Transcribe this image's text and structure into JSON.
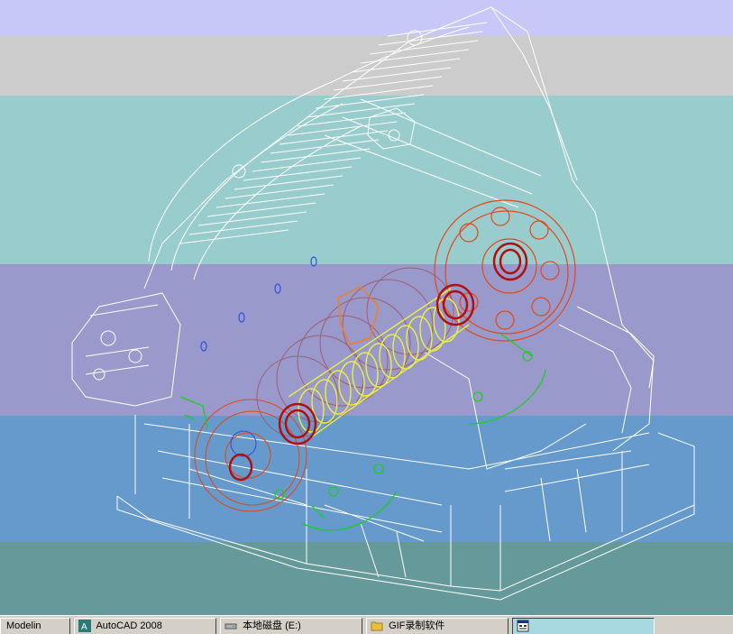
{
  "app": {
    "name": "AutoCAD 2008",
    "view_mode": "3D wireframe model view"
  },
  "background_bands": [
    "#c8c8f8",
    "#cccccc",
    "#99cccc",
    "#9999cc",
    "#6699cc",
    "#669999"
  ],
  "model_colors": {
    "frame": "#ffffff",
    "gears": "#e04a1a",
    "bearings": "#b01010",
    "shaft": "#e8f040",
    "brackets": "#22cc22",
    "accents": "#3050e0"
  },
  "taskbar": {
    "items": [
      {
        "label": "Modelin",
        "icon": "none"
      },
      {
        "label": "AutoCAD 2008",
        "icon": "autocad-icon"
      },
      {
        "label": "本地磁盘 (E:)",
        "icon": "drive-icon"
      },
      {
        "label": "GIF录制软件",
        "icon": "folder-icon"
      },
      {
        "label": "",
        "icon": "app-window-icon"
      }
    ]
  }
}
